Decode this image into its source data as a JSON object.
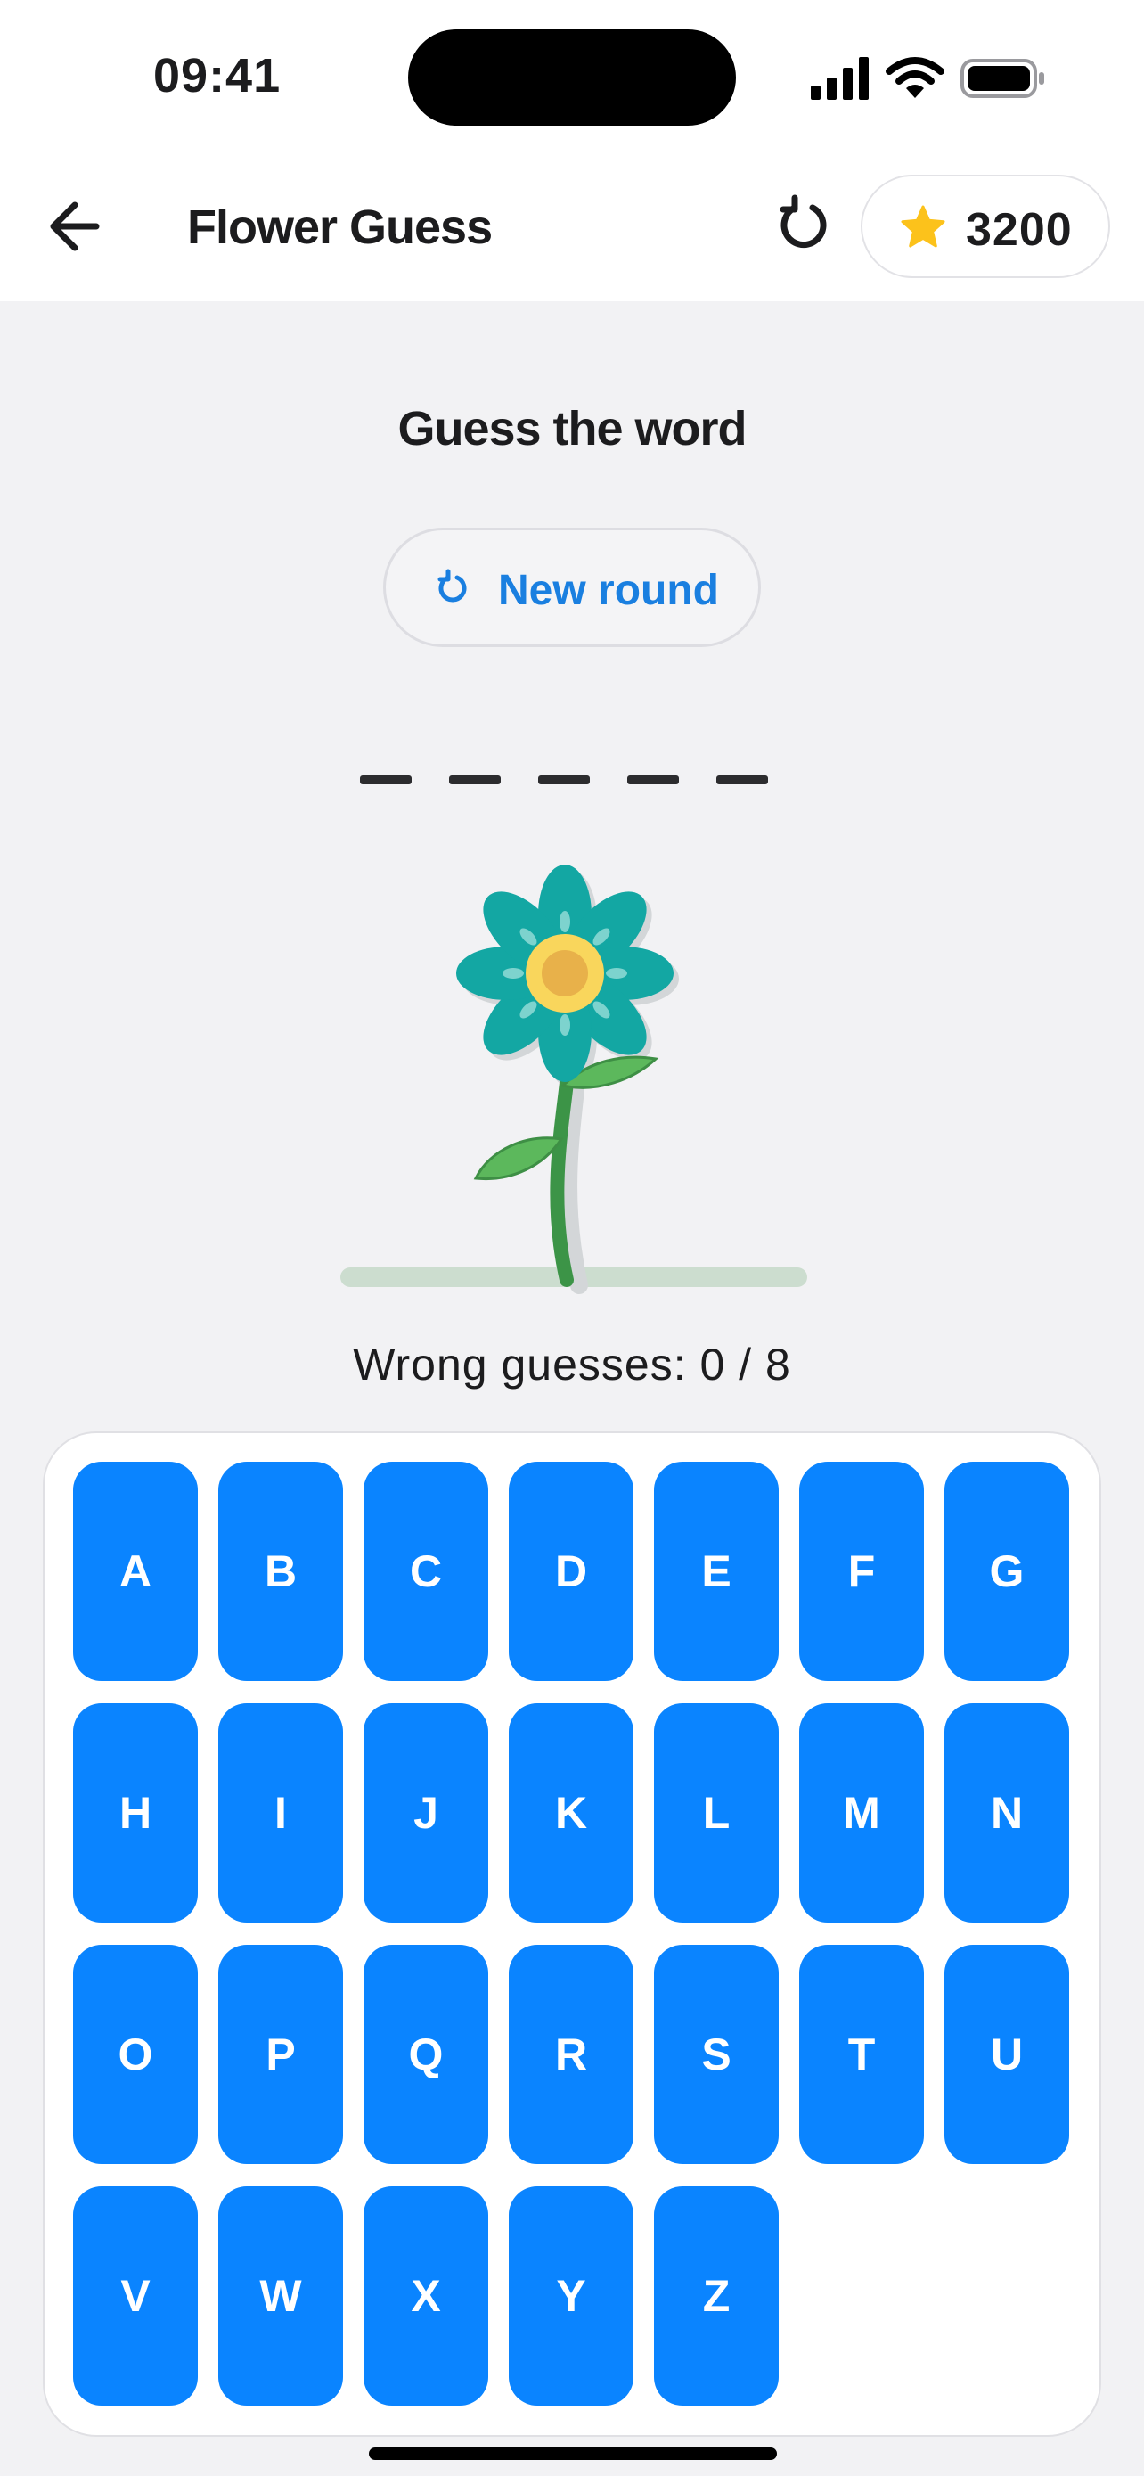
{
  "status_bar": {
    "time": "09:41",
    "icons": [
      "signal-icon",
      "wifi-icon",
      "battery-icon"
    ]
  },
  "header": {
    "title": "Flower Guess",
    "score": "3200",
    "icons": [
      "back-arrow-icon",
      "refresh-icon",
      "star-icon"
    ]
  },
  "game": {
    "headline": "Guess the word",
    "new_round_label": "New round",
    "word_length": 5,
    "wrong_label": "Wrong guesses: 0 / 8",
    "wrong_count": 0,
    "max_wrong": 8
  },
  "keyboard": {
    "keys": [
      "A",
      "B",
      "C",
      "D",
      "E",
      "F",
      "G",
      "H",
      "I",
      "J",
      "K",
      "L",
      "M",
      "N",
      "O",
      "P",
      "Q",
      "R",
      "S",
      "T",
      "U",
      "V",
      "W",
      "X",
      "Y",
      "Z"
    ]
  },
  "colors": {
    "accent": "#0A84FF",
    "link": "#1A7FE0",
    "background": "#F2F2F4",
    "petal": "#13A7A3",
    "flower_center": "#F9D65C",
    "stem": "#3C9447",
    "star": "#FCC21B"
  }
}
